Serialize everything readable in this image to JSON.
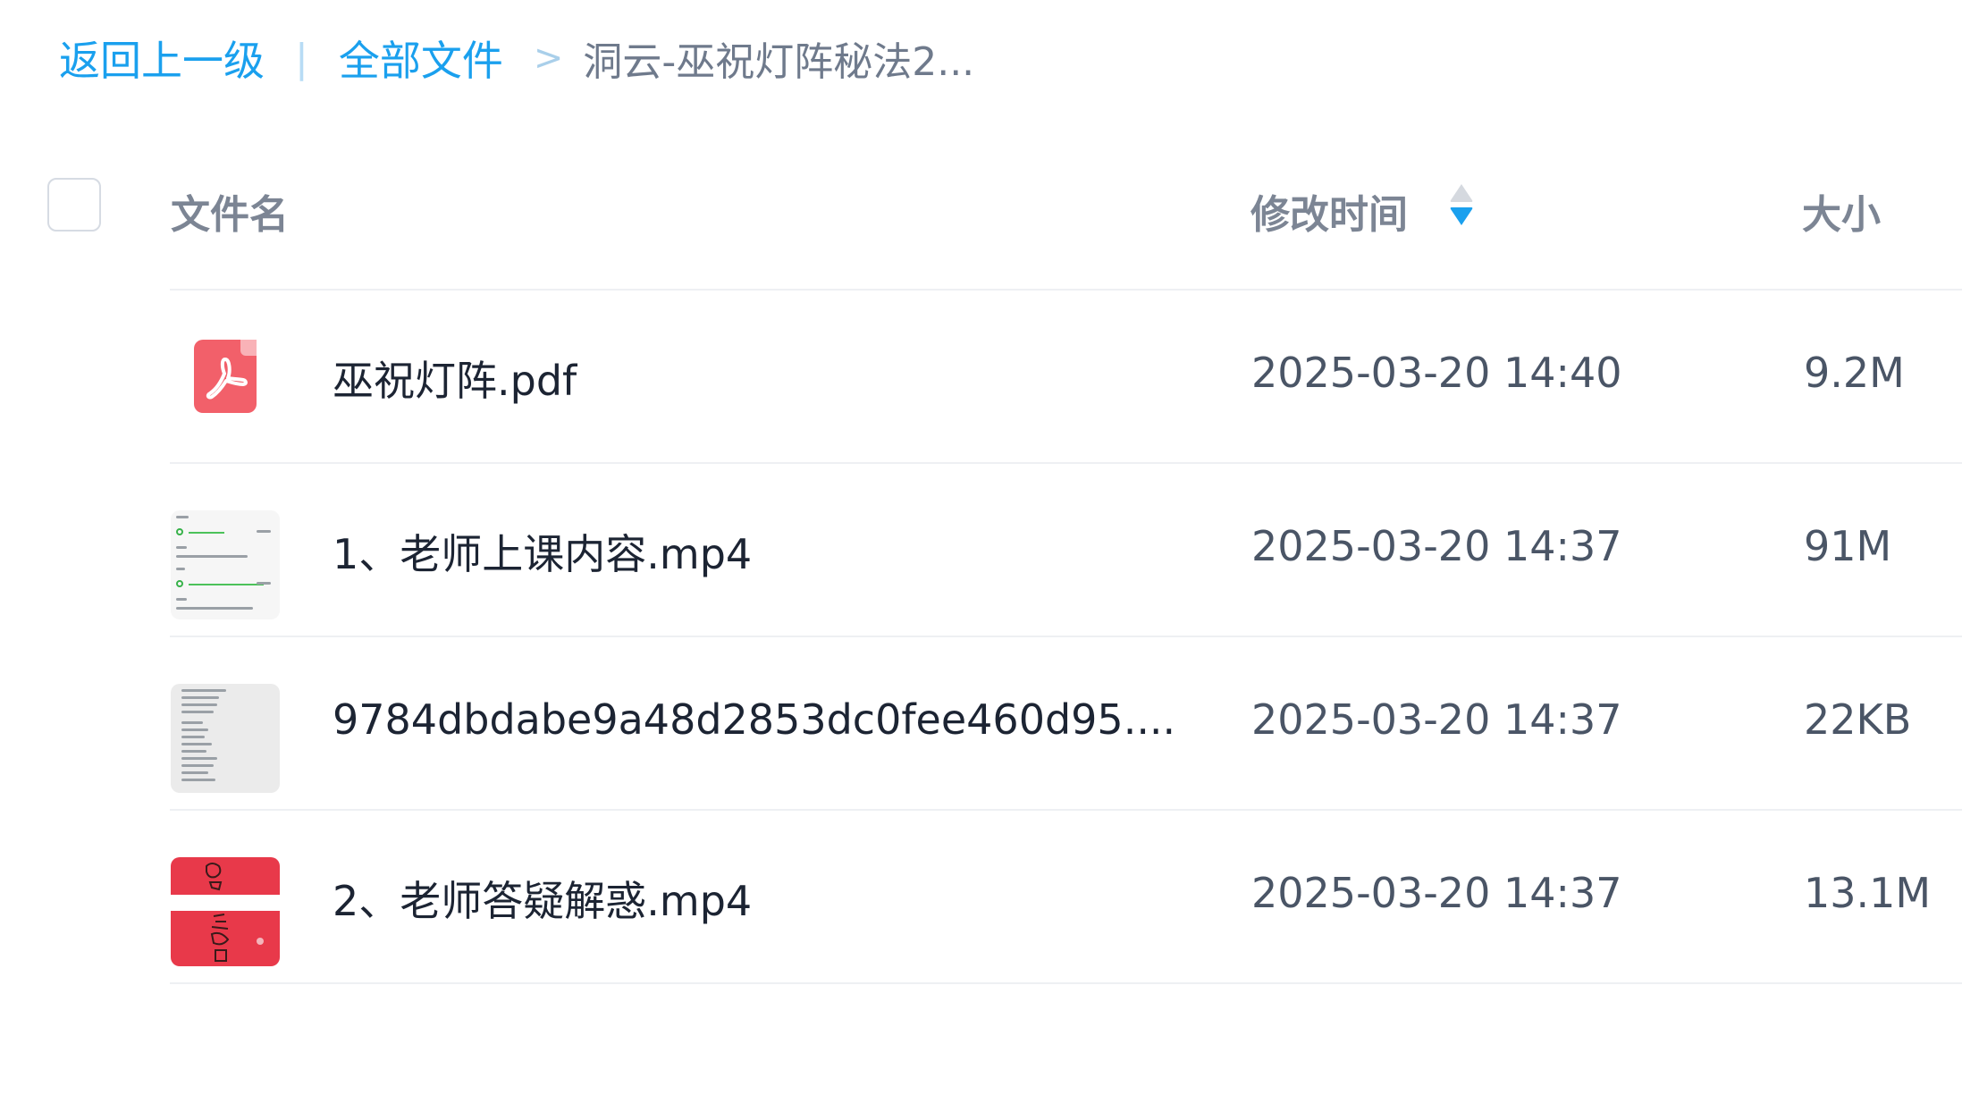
{
  "breadcrumb": {
    "back_label": "返回上一级",
    "divider": "|",
    "all_files_label": "全部文件",
    "arrow": ">",
    "current_folder": "洞云-巫祝灯阵秘法2..."
  },
  "table": {
    "headers": {
      "name": "文件名",
      "modified": "修改时间",
      "size": "大小"
    },
    "sort": {
      "column": "modified",
      "direction": "descending"
    },
    "rows": [
      {
        "icon": "pdf-file-icon",
        "name": "巫祝灯阵.pdf",
        "modified": "2025-03-20 14:40",
        "size": "9.2M"
      },
      {
        "icon": "video-thumbnail",
        "name": "1、老师上课内容.mp4",
        "modified": "2025-03-20 14:37",
        "size": "91M"
      },
      {
        "icon": "image-thumbnail",
        "name": "9784dbdabe9a48d2853dc0fee460d95....",
        "modified": "2025-03-20 14:37",
        "size": "22KB"
      },
      {
        "icon": "video-thumbnail",
        "name": "2、老师答疑解惑.mp4",
        "modified": "2025-03-20 14:37",
        "size": "13.1M"
      }
    ]
  },
  "colors": {
    "link": "#1aa0ee",
    "pdf_red": "#f2606a",
    "sort_active": "#1aa0ee",
    "text_primary": "#1c2433",
    "text_secondary": "#4a5566"
  }
}
